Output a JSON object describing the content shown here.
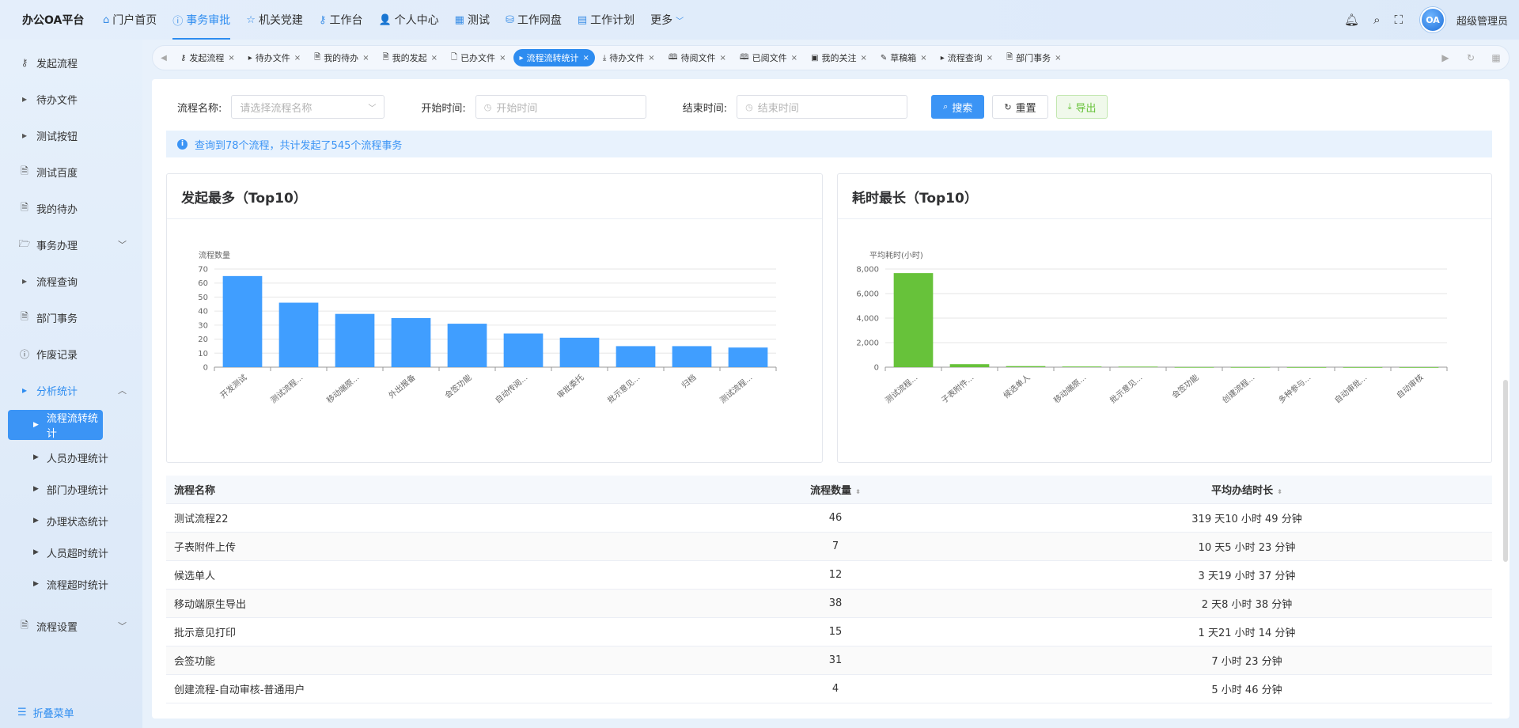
{
  "app": {
    "title": "办公OA平台",
    "user": "超级管理员",
    "avatar_text": "OA"
  },
  "topnav": [
    {
      "label": "门户首页",
      "icon": "home-icon",
      "glyph": "⌂"
    },
    {
      "label": "事务审批",
      "icon": "info-circle-icon",
      "glyph": "ⓘ",
      "active": true
    },
    {
      "label": "机关党建",
      "icon": "star-icon",
      "glyph": "☆"
    },
    {
      "label": "工作台",
      "icon": "sitemap-icon",
      "glyph": "⚷"
    },
    {
      "label": "个人中心",
      "icon": "user-icon",
      "glyph": "👤"
    },
    {
      "label": "测试",
      "icon": "grid-icon",
      "glyph": "▦"
    },
    {
      "label": "工作网盘",
      "icon": "database-icon",
      "glyph": "⛁"
    },
    {
      "label": "工作计划",
      "icon": "calendar-icon",
      "glyph": "▤"
    }
  ],
  "topnav_more": "更多",
  "sidebar": {
    "items": [
      {
        "label": "发起流程",
        "icon": "sitemap-icon",
        "glyph": "⚷"
      },
      {
        "label": "待办文件",
        "icon": "caret-right-icon",
        "glyph": "▸"
      },
      {
        "label": "测试按钮",
        "icon": "caret-right-icon",
        "glyph": "▸"
      },
      {
        "label": "测试百度",
        "icon": "document-icon",
        "glyph": "🗎"
      },
      {
        "label": "我的待办",
        "icon": "document-icon",
        "glyph": "🗎"
      },
      {
        "label": "事务办理",
        "icon": "folder-open-icon",
        "glyph": "🗁",
        "chevron": "﹀"
      },
      {
        "label": "流程查询",
        "icon": "caret-right-icon",
        "glyph": "▸"
      },
      {
        "label": "部门事务",
        "icon": "document-icon",
        "glyph": "🗎"
      },
      {
        "label": "作废记录",
        "icon": "alert-circle-icon",
        "glyph": "ⓘ"
      },
      {
        "label": "分析统计",
        "icon": "caret-right-icon",
        "glyph": "▸",
        "chevron": "︿",
        "open": true
      }
    ],
    "subitems": [
      {
        "label": "流程流转统计",
        "active": true
      },
      {
        "label": "人员办理统计"
      },
      {
        "label": "部门办理统计"
      },
      {
        "label": "办理状态统计"
      },
      {
        "label": "人员超时统计"
      },
      {
        "label": "流程超时统计"
      }
    ],
    "after": {
      "label": "流程设置",
      "icon": "document-icon",
      "glyph": "🗎",
      "chevron": "﹀"
    },
    "collapse_label": "折叠菜单"
  },
  "tabs": [
    {
      "label": "发起流程",
      "glyph": "⚷"
    },
    {
      "label": "待办文件",
      "glyph": "▸"
    },
    {
      "label": "我的待办",
      "glyph": "🗎"
    },
    {
      "label": "我的发起",
      "glyph": "🗎"
    },
    {
      "label": "已办文件",
      "glyph": "🗋"
    },
    {
      "label": "流程流转统计",
      "glyph": "▸",
      "active": true
    },
    {
      "label": "待办文件",
      "glyph": "⤓"
    },
    {
      "label": "待阅文件",
      "glyph": "🕮"
    },
    {
      "label": "已阅文件",
      "glyph": "🕮"
    },
    {
      "label": "我的关注",
      "glyph": "▣"
    },
    {
      "label": "草稿箱",
      "glyph": "✎"
    },
    {
      "label": "流程查询",
      "glyph": "▸"
    },
    {
      "label": "部门事务",
      "glyph": "🗎"
    }
  ],
  "filter": {
    "name_label": "流程名称:",
    "name_placeholder": "请选择流程名称",
    "start_label": "开始时间:",
    "start_placeholder": "开始时间",
    "end_label": "结束时间:",
    "end_placeholder": "结束时间",
    "search_btn": "搜索",
    "reset_btn": "重置",
    "export_btn": "导出"
  },
  "alert_text": "查询到78个流程，共计发起了545个流程事务",
  "charts": {
    "left_title": "发起最多（Top10）",
    "right_title": "耗时最长（Top10）"
  },
  "chart_data": [
    {
      "type": "bar",
      "title": "发起最多（Top10）",
      "ylabel": "流程数量",
      "categories": [
        "开发测试",
        "测试流程...",
        "移动端原...",
        "外出报备",
        "会签功能",
        "自动传阅...",
        "审批委托",
        "批示意见...",
        "归档",
        "测试流程..."
      ],
      "values": [
        65,
        46,
        38,
        35,
        31,
        24,
        21,
        15,
        15,
        14
      ],
      "ylim": [
        0,
        70
      ],
      "yticks": [
        0,
        10,
        20,
        30,
        40,
        50,
        60,
        70
      ],
      "color": "#409eff",
      "grid": true
    },
    {
      "type": "bar",
      "title": "耗时最长（Top10）",
      "ylabel": "平均耗时(小时)",
      "categories": [
        "测试流程...",
        "子表附件...",
        "候选单人",
        "移动端原...",
        "批示意见...",
        "会签功能",
        "创建流程...",
        "多种参与...",
        "自动审批...",
        "自动审核"
      ],
      "values": [
        7670,
        245,
        85,
        54,
        45,
        7.4,
        5.8,
        3,
        2,
        1
      ],
      "ylim": [
        0,
        8000
      ],
      "yticks": [
        0,
        2000,
        4000,
        6000,
        8000
      ],
      "ytick_labels": [
        "0",
        "2,000",
        "4,000",
        "6,000",
        "8,000"
      ],
      "color": "#67c23a",
      "grid": true
    }
  ],
  "table": {
    "headers": [
      "流程名称",
      "流程数量",
      "平均办结时长"
    ],
    "rows": [
      [
        "测试流程22",
        "46",
        "319 天10 小时 49 分钟"
      ],
      [
        "子表附件上传",
        "7",
        "10 天5 小时 23 分钟"
      ],
      [
        "候选单人",
        "12",
        "3 天19 小时 37 分钟"
      ],
      [
        "移动端原生导出",
        "38",
        "2 天8 小时 38 分钟"
      ],
      [
        "批示意见打印",
        "15",
        "1 天21 小时 14 分钟"
      ],
      [
        "会签功能",
        "31",
        "7 小时 23 分钟"
      ],
      [
        "创建流程-自动审核-普通用户",
        "4",
        "5 小时 46 分钟"
      ]
    ]
  }
}
